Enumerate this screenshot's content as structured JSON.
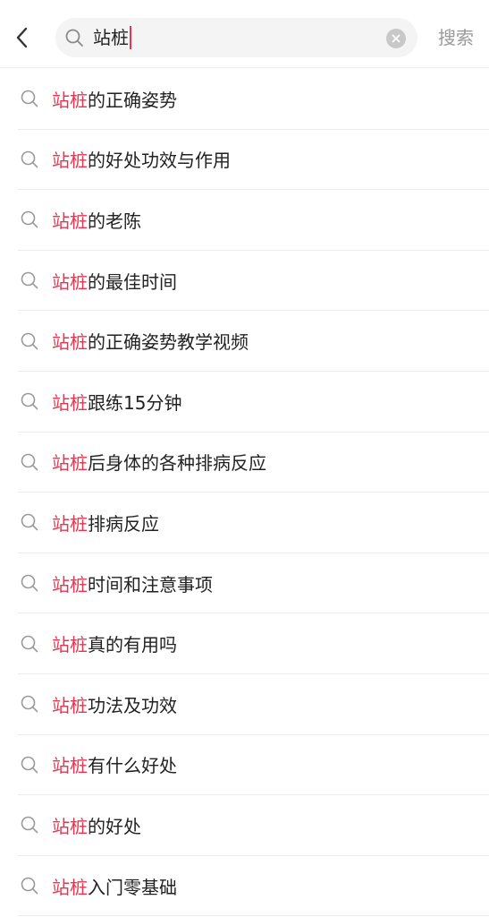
{
  "search": {
    "query": "站桩",
    "button_label": "搜索"
  },
  "suggestions": [
    {
      "highlight": "站桩",
      "rest": "的正确姿势"
    },
    {
      "highlight": "站桩",
      "rest": "的好处功效与作用"
    },
    {
      "highlight": "站桩",
      "rest": "的老陈"
    },
    {
      "highlight": "站桩",
      "rest": "的最佳时间"
    },
    {
      "highlight": "站桩",
      "rest": "的正确姿势教学视频"
    },
    {
      "highlight": "站桩",
      "rest": "跟练15分钟"
    },
    {
      "highlight": "站桩",
      "rest": "后身体的各种排病反应"
    },
    {
      "highlight": "站桩",
      "rest": "排病反应"
    },
    {
      "highlight": "站桩",
      "rest": "时间和注意事项"
    },
    {
      "highlight": "站桩",
      "rest": "真的有用吗"
    },
    {
      "highlight": "站桩",
      "rest": "功法及功效"
    },
    {
      "highlight": "站桩",
      "rest": "有什么好处"
    },
    {
      "highlight": "站桩",
      "rest": "的好处"
    },
    {
      "highlight": "站桩",
      "rest": "入门零基础"
    }
  ],
  "colors": {
    "highlight": "#e8344e",
    "text": "#222222",
    "muted": "#9a9a9a"
  }
}
